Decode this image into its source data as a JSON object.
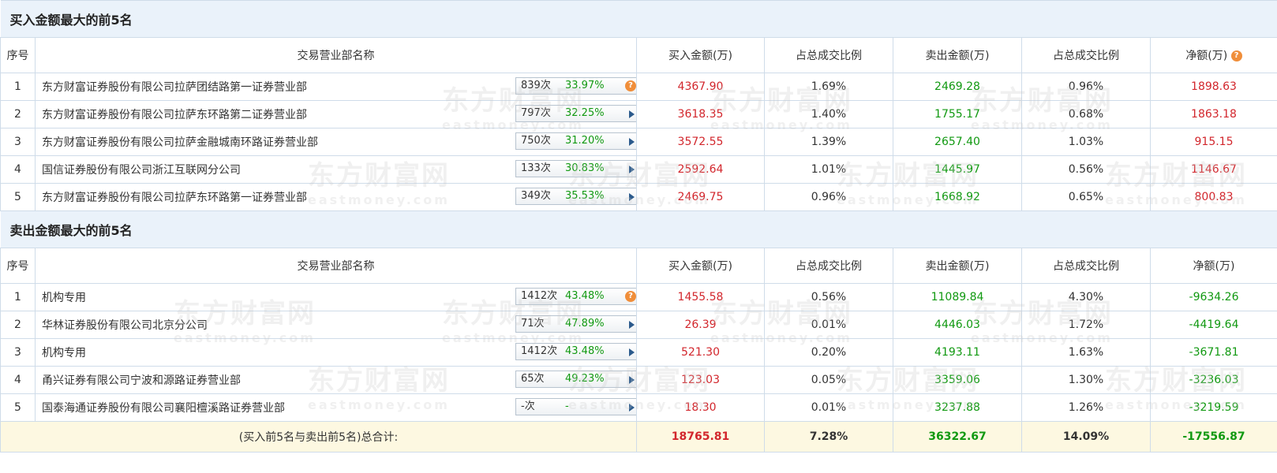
{
  "buy_section": {
    "title": "买入金额最大的前5名",
    "headers": [
      "序号",
      "交易营业部名称",
      "买入金额(万)",
      "占总成交比例",
      "卖出金额(万)",
      "占总成交比例",
      "净额(万)"
    ],
    "rows": [
      {
        "idx": "1",
        "name": "东方财富证券股份有限公司拉萨团结路第一证券营业部",
        "count": "839次",
        "pct": "33.97%",
        "icon": "question-icon",
        "buy": "4367.90",
        "buy_ratio": "1.69%",
        "sell": "2469.28",
        "sell_ratio": "0.96%",
        "net": "1898.63"
      },
      {
        "idx": "2",
        "name": "东方财富证券股份有限公司拉萨东环路第二证券营业部",
        "count": "797次",
        "pct": "32.25%",
        "icon": "arrow-right-icon",
        "buy": "3618.35",
        "buy_ratio": "1.40%",
        "sell": "1755.17",
        "sell_ratio": "0.68%",
        "net": "1863.18"
      },
      {
        "idx": "3",
        "name": "东方财富证券股份有限公司拉萨金融城南环路证券营业部",
        "count": "750次",
        "pct": "31.20%",
        "icon": "arrow-right-icon",
        "buy": "3572.55",
        "buy_ratio": "1.39%",
        "sell": "2657.40",
        "sell_ratio": "1.03%",
        "net": "915.15"
      },
      {
        "idx": "4",
        "name": "国信证券股份有限公司浙江互联网分公司",
        "count": "133次",
        "pct": "30.83%",
        "icon": "arrow-right-icon",
        "buy": "2592.64",
        "buy_ratio": "1.01%",
        "sell": "1445.97",
        "sell_ratio": "0.56%",
        "net": "1146.67"
      },
      {
        "idx": "5",
        "name": "东方财富证券股份有限公司拉萨东环路第一证券营业部",
        "count": "349次",
        "pct": "35.53%",
        "icon": "arrow-right-icon",
        "buy": "2469.75",
        "buy_ratio": "0.96%",
        "sell": "1668.92",
        "sell_ratio": "0.65%",
        "net": "800.83"
      }
    ]
  },
  "sell_section": {
    "title": "卖出金额最大的前5名",
    "headers": [
      "序号",
      "交易营业部名称",
      "买入金额(万)",
      "占总成交比例",
      "卖出金额(万)",
      "占总成交比例",
      "净额(万)"
    ],
    "rows": [
      {
        "idx": "1",
        "name": "机构专用",
        "count": "1412次",
        "pct": "43.48%",
        "icon": "question-icon",
        "buy": "1455.58",
        "buy_ratio": "0.56%",
        "sell": "11089.84",
        "sell_ratio": "4.30%",
        "net": "-9634.26"
      },
      {
        "idx": "2",
        "name": "华林证券股份有限公司北京分公司",
        "count": "71次",
        "pct": "47.89%",
        "icon": "arrow-right-icon",
        "buy": "26.39",
        "buy_ratio": "0.01%",
        "sell": "4446.03",
        "sell_ratio": "1.72%",
        "net": "-4419.64"
      },
      {
        "idx": "3",
        "name": "机构专用",
        "count": "1412次",
        "pct": "43.48%",
        "icon": "arrow-right-icon",
        "buy": "521.30",
        "buy_ratio": "0.20%",
        "sell": "4193.11",
        "sell_ratio": "1.63%",
        "net": "-3671.81"
      },
      {
        "idx": "4",
        "name": "甬兴证券有限公司宁波和源路证券营业部",
        "count": "65次",
        "pct": "49.23%",
        "icon": "arrow-right-icon",
        "buy": "123.03",
        "buy_ratio": "0.05%",
        "sell": "3359.06",
        "sell_ratio": "1.30%",
        "net": "-3236.03"
      },
      {
        "idx": "5",
        "name": "国泰海通证券股份有限公司襄阳檀溪路证券营业部",
        "count": "-次",
        "pct": "-",
        "icon": "arrow-right-icon",
        "buy": "18.30",
        "buy_ratio": "0.01%",
        "sell": "3237.88",
        "sell_ratio": "1.26%",
        "net": "-3219.59"
      }
    ]
  },
  "total": {
    "label": "(买入前5名与卖出前5名)总合计:",
    "buy": "18765.81",
    "buy_ratio": "7.28%",
    "sell": "36322.67",
    "sell_ratio": "14.09%",
    "net": "-17556.87"
  },
  "watermark": {
    "cn": "东方财富网",
    "en": "eastmoney.com"
  },
  "colors": {
    "buy": "#d2262c",
    "sell": "#119911",
    "header_bg": "#eaf2fa",
    "total_bg": "#fdf8e1",
    "help_icon": "#f08e3a"
  }
}
